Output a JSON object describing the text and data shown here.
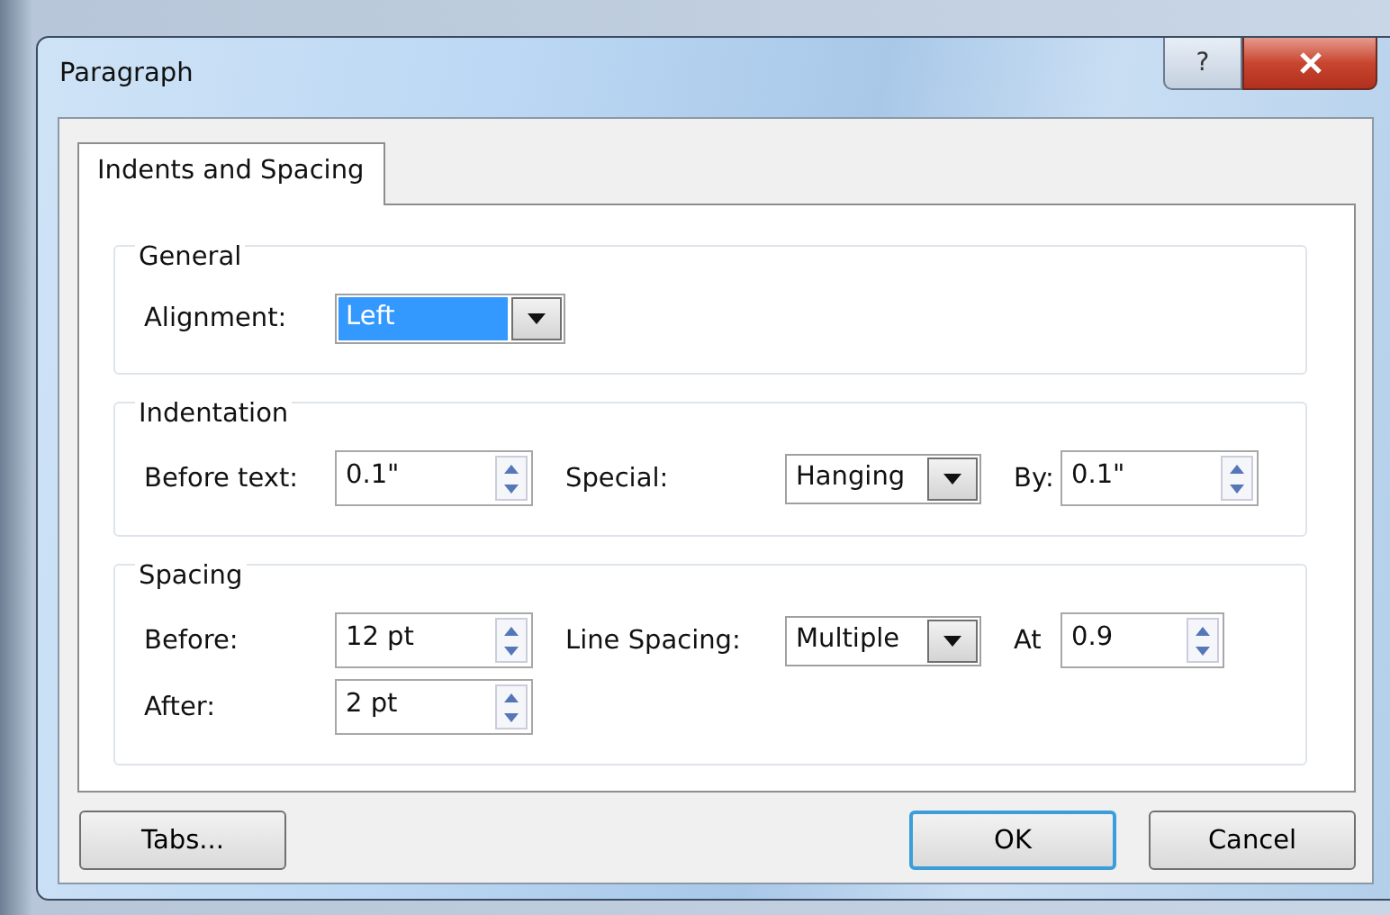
{
  "window": {
    "title": "Paragraph",
    "help": "?"
  },
  "tabs": [
    {
      "label": "Indents and Spacing",
      "selected": true
    }
  ],
  "groups": [
    {
      "title": "General",
      "rows": [
        [
          {
            "label": "Alignment:",
            "kind": "dropdown",
            "value": "Left",
            "highlighted": true
          }
        ]
      ]
    },
    {
      "title": "Indentation",
      "rows": [
        [
          {
            "label": "Before text:",
            "kind": "spin",
            "value": "0.1\""
          },
          {
            "label": "Special:",
            "kind": "dropdown",
            "value": "Hanging",
            "highlighted": false
          },
          {
            "label": "By:",
            "kind": "spin",
            "value": "0.1\""
          }
        ]
      ]
    },
    {
      "title": "Spacing",
      "rows": [
        [
          {
            "label": "Before:",
            "kind": "spin",
            "value": "12 pt"
          },
          {
            "label": "Line Spacing:",
            "kind": "dropdown",
            "value": "Multiple",
            "highlighted": false
          },
          {
            "label": "At",
            "kind": "spin",
            "value": "0.9",
            "narrow": true
          }
        ],
        [
          {
            "label": "After:",
            "kind": "spin",
            "value": "2 pt"
          }
        ]
      ]
    }
  ],
  "buttons": [
    {
      "label": "Tabs...",
      "default": false
    },
    {
      "label": "OK",
      "default": true
    },
    {
      "label": "Cancel",
      "default": false
    }
  ]
}
